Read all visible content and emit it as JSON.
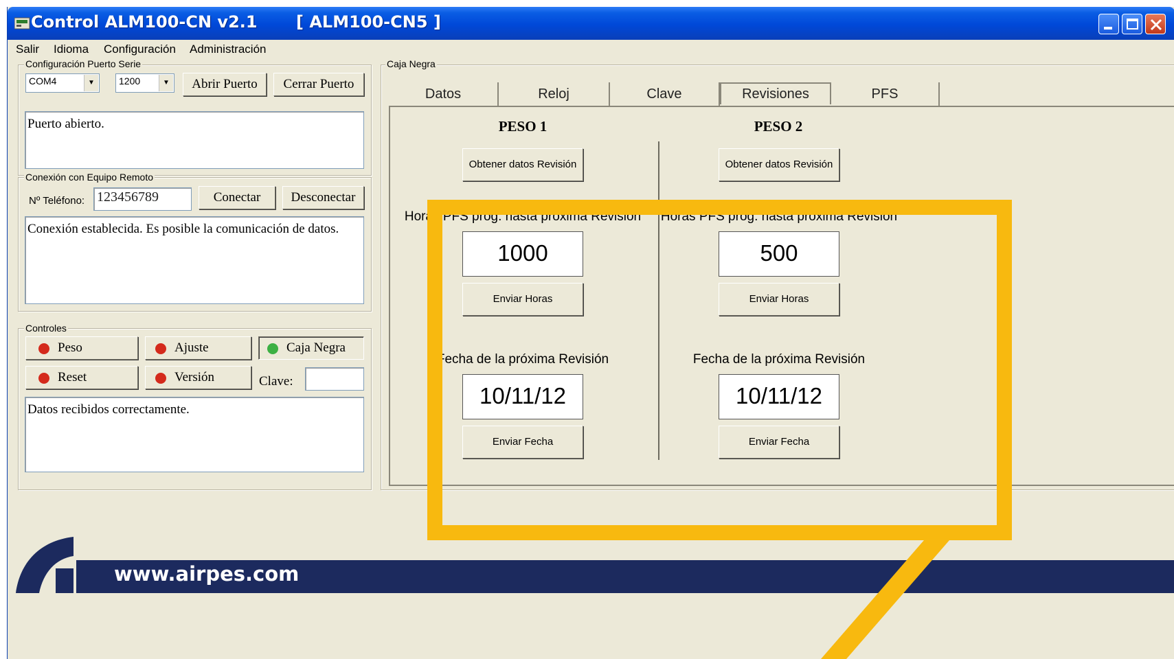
{
  "window": {
    "title": "Control ALM100-CN v2.1",
    "device": "[ ALM100-CN5  ]"
  },
  "menu": [
    "Salir",
    "Idioma",
    "Configuración",
    "Administración"
  ],
  "serial": {
    "legend": "Configuración Puerto Serie",
    "port_value": "COM4",
    "baud_value": "1200",
    "open_label": "Abrir Puerto",
    "close_label": "Cerrar Puerto",
    "status_text": "Puerto abierto."
  },
  "remote": {
    "legend": "Conexión con Equipo Remoto",
    "phone_label": "Nº Teléfono:",
    "phone_value": "123456789",
    "connect_label": "Conectar",
    "disconnect_label": "Desconectar",
    "status_text": "Conexión establecida. Es posible la comunicación de datos."
  },
  "controls": {
    "legend": "Controles",
    "peso_label": "Peso",
    "ajuste_label": "Ajuste",
    "caja_negra_label": "Caja Negra",
    "reset_label": "Reset",
    "version_label": "Versión",
    "clave_label": "Clave:",
    "clave_value": "",
    "status_text": "Datos recibidos correctamente.",
    "led_red": "#d42a1c",
    "led_green": "#3cb043"
  },
  "blackbox": {
    "legend": "Caja Negra",
    "tabs": [
      "Datos",
      "Reloj",
      "Clave",
      "Revisiones",
      "PFS"
    ],
    "active_tab": "Revisiones",
    "peso1": {
      "title": "PESO 1",
      "get_label": "Obtener datos Revisión",
      "hours_label": "Horas PFS prog. hasta próxima Revisión",
      "hours_value": "1000",
      "send_hours_label": "Enviar Horas",
      "date_label": "Fecha de la próxima Revisión",
      "date_value": "10/11/12",
      "send_date_label": "Enviar Fecha"
    },
    "peso2": {
      "title": "PESO 2",
      "get_label": "Obtener datos Revisión",
      "hours_label": "Horas PFS prog. hasta próxima Revisión",
      "hours_value": "500",
      "send_hours_label": "Enviar Horas",
      "date_label": "Fecha de la próxima Revisión",
      "date_value": "10/11/12",
      "send_date_label": "Enviar Fecha"
    }
  },
  "footer": {
    "url": "www.airpes.com"
  },
  "colors": {
    "highlight": "#f8b90f",
    "footer_band": "#1c2a5e",
    "titlebar": "#0a5de4"
  }
}
